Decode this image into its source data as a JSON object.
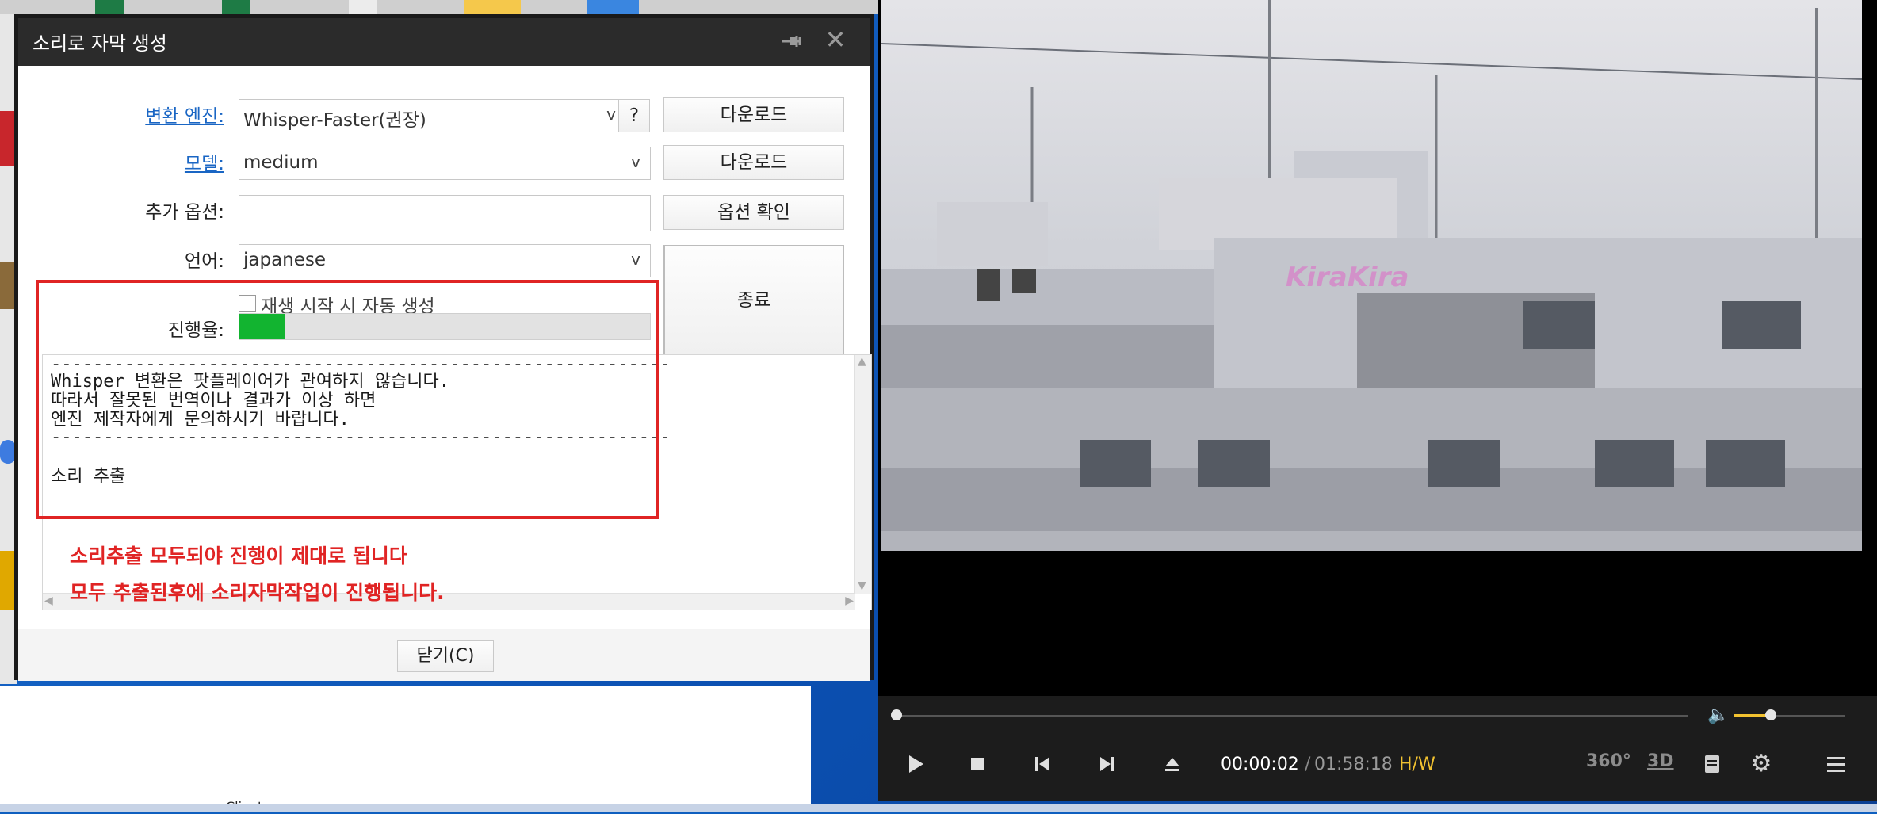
{
  "dialog": {
    "title": "소리로 자막 생성",
    "engine_label": "변환 엔진:",
    "engine_value": "Whisper-Faster(권장)",
    "help_button": "?",
    "download_button_1": "다운로드",
    "model_label": "모델:",
    "model_value": "medium",
    "download_button_2": "다운로드",
    "extra_options_label": "추가 옵션:",
    "extra_options_value": "",
    "check_options_button": "옵션 확인",
    "language_label": "언어:",
    "language_value": "japanese",
    "stop_button": "종료",
    "autostart_checkbox_label": "재생 시작 시 자동 생성",
    "progress_label": "진행율:",
    "progress_fraction": 0.11,
    "log_lines": [
      "-----------------------------------------------------------",
      "Whisper 변환은 팟플레이어가 관여하지 않습니다.",
      "따라서 잘못된 번역이나 결과가 이상 하면",
      "엔진 제작자에게 문의하시기 바랍니다.",
      "-----------------------------------------------------------",
      "",
      "소리 추출"
    ],
    "close_button": "닫기(C)"
  },
  "annotation": {
    "line1": "소리추출 모두되야 진행이 제대로 됩니다",
    "line2": "모두 추출된후에 소리자막작업이 진행됩니다.",
    "color": "#e02424"
  },
  "player": {
    "watermark": "KiraKira",
    "current_time": "00:00:02",
    "separator": "/",
    "total_time": "01:58:18",
    "hw_badge": "H/W",
    "badge_360": "360°",
    "badge_3d": "3D",
    "seek_fraction": 0.0,
    "volume_fraction": 0.33,
    "icons": [
      "play-icon",
      "stop-icon",
      "prev-icon",
      "next-icon",
      "eject-icon",
      "speaker-icon",
      "vr360-icon",
      "3d-icon",
      "subtitle-icon",
      "gear-icon",
      "menu-icon"
    ]
  },
  "desktop": {
    "client_label": "Client"
  }
}
